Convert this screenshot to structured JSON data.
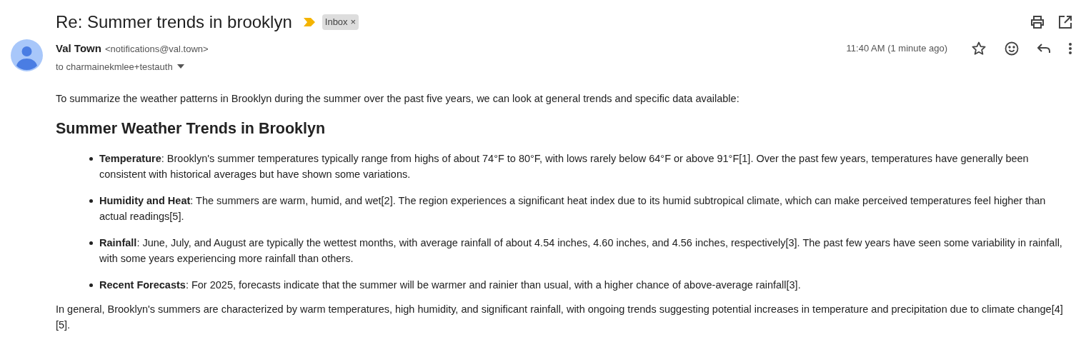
{
  "subject": "Re: Summer trends in brooklyn",
  "important": true,
  "label": {
    "text": "Inbox",
    "close": "×"
  },
  "sender": {
    "name": "Val Town",
    "email": "<notifications@val.town>",
    "to": "to charmainekmlee+testauth"
  },
  "time": "11:40 AM (1 minute ago)",
  "starred": false,
  "body": {
    "intro": "To summarize the weather patterns in Brooklyn during the summer over the past five years, we can look at general trends and specific data available:",
    "heading": "Summer Weather Trends in Brooklyn",
    "bullets": [
      "**Temperature**: Brooklyn's summer temperatures typically range from highs of about 74°F to 80°F, with lows rarely below 64°F or above 91°F[1]. Over the past few years, temperatures have generally been consistent with historical averages but have shown some variations.",
      "**Humidity and Heat**: The summers are warm, humid, and wet[2]. The region experiences a significant heat index due to its humid subtropical climate, which can make perceived temperatures feel higher than actual readings[5].",
      "**Rainfall**: June, July, and August are typically the wettest months, with average rainfall of about 4.54 inches, 4.60 inches, and 4.56 inches, respectively[3]. The past few years have seen some variability in rainfall, with some years experiencing more rainfall than others.",
      "**Recent Forecasts**: For 2025, forecasts indicate that the summer will be warmer and rainier than usual, with a higher chance of above-average rainfall[3]."
    ],
    "conclusion": "In general, Brooklyn's summers are characterized by warm temperatures, high humidity, and significant rainfall, with ongoing trends suggesting potential increases in temperature and precipitation due to climate change[4][5]."
  }
}
